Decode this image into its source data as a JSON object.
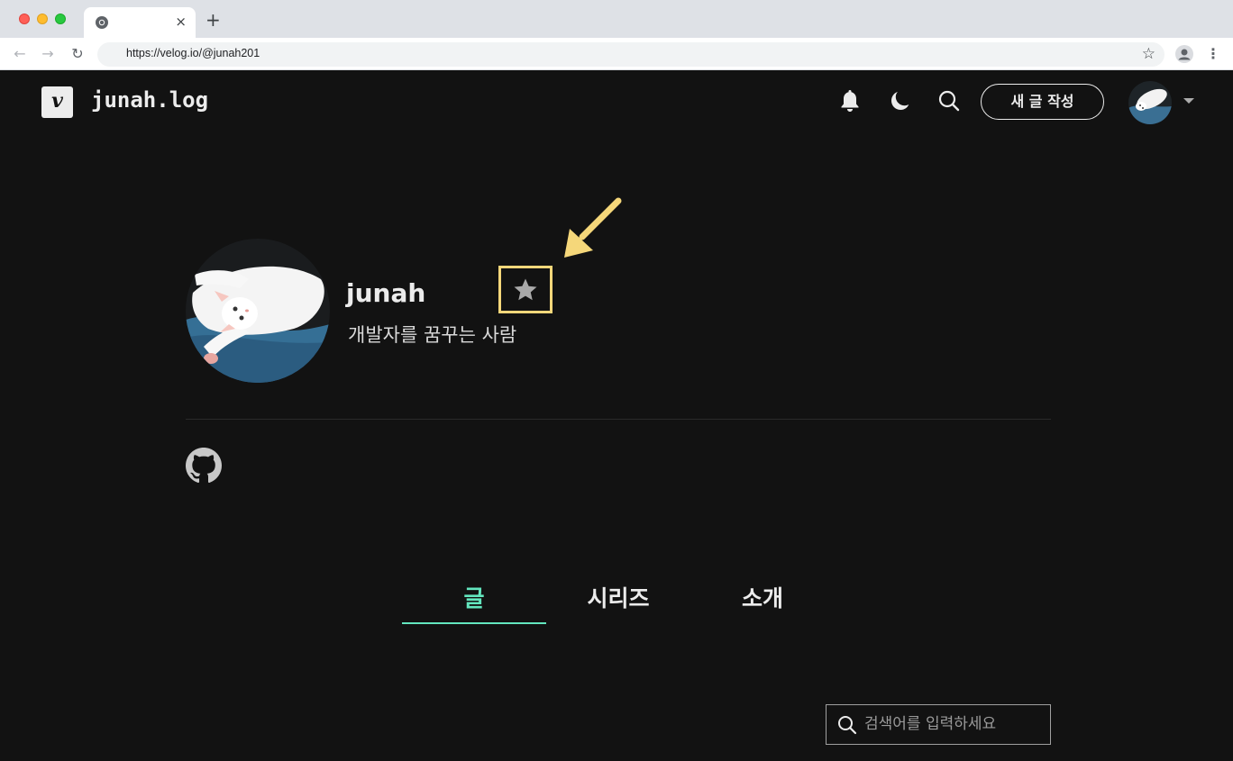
{
  "browser": {
    "tab_close": "×",
    "new_tab": "+",
    "url": "https://velog.io/@junah201",
    "nav": {
      "back": "←",
      "forward": "→",
      "reload": "↻"
    },
    "bookmark": "☆",
    "menu": "⋮"
  },
  "header": {
    "logo_letter": "v",
    "blog_title": "junah.log",
    "write_button": "새 글 작성",
    "icons": [
      "bell-icon",
      "moon-icon",
      "search-icon",
      "chevron-down-icon"
    ]
  },
  "profile": {
    "name": "junah",
    "description": "개발자를 꿈꾸는 사람",
    "highlight_color": "#f5d77a"
  },
  "tabs": [
    {
      "label": "글",
      "active": true
    },
    {
      "label": "시리즈",
      "active": false
    },
    {
      "label": "소개",
      "active": false
    }
  ],
  "search": {
    "placeholder": "검색어를 입력하세요"
  },
  "colors": {
    "background": "#121212",
    "accent": "#63e6be",
    "text": "#ececec"
  }
}
